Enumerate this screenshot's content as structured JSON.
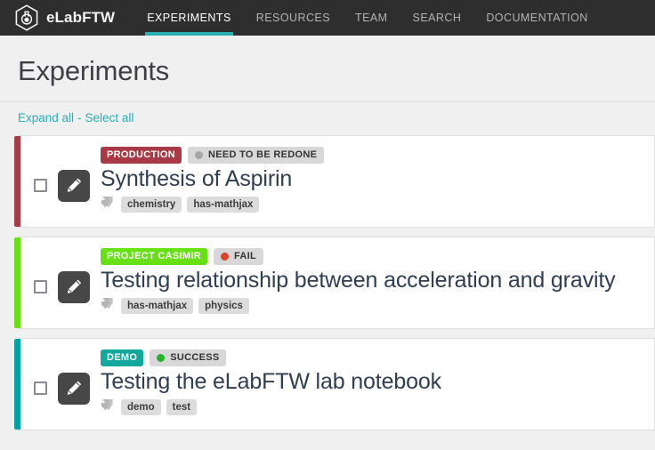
{
  "navbar": {
    "brand": "eLabFTW",
    "logo_icon": "elabftw-hexagon-flask-logo",
    "items": [
      {
        "label": "EXPERIMENTS",
        "active": true
      },
      {
        "label": "RESOURCES",
        "active": false
      },
      {
        "label": "TEAM",
        "active": false
      },
      {
        "label": "SEARCH",
        "active": false
      },
      {
        "label": "DOCUMENTATION",
        "active": false
      }
    ],
    "accent_color": "#29aeb4",
    "background_color": "#2e2e2e"
  },
  "page": {
    "title": "Experiments"
  },
  "actions": {
    "expand_all": "Expand all",
    "separator": "-",
    "select_all": "Select all",
    "link_color": "#29aeb4"
  },
  "experiments": [
    {
      "accent_color": "#a83a45",
      "category": "PRODUCTION",
      "category_color": "#a83a45",
      "status": "NEED TO BE REDONE",
      "status_dot_color": "#a6a6a6",
      "title": "Synthesis of Aspirin",
      "tags": [
        "chemistry",
        "has-mathjax"
      ],
      "edit_icon": "pencil-icon",
      "tags_icon": "tags-icon"
    },
    {
      "accent_color": "#67e016",
      "category": "PROJECT CASIMIR",
      "category_color": "#67e016",
      "status": "FAIL",
      "status_dot_color": "#d9442a",
      "title": "Testing relationship between acceleration and gravity",
      "tags": [
        "has-mathjax",
        "physics"
      ],
      "edit_icon": "pencil-icon",
      "tags_icon": "tags-icon"
    },
    {
      "accent_color": "#00a3a3",
      "category": "DEMO",
      "category_color": "#12a89d",
      "status": "SUCCESS",
      "status_dot_color": "#29b32a",
      "title": "Testing the eLabFTW lab notebook",
      "tags": [
        "demo",
        "test"
      ],
      "edit_icon": "pencil-icon",
      "tags_icon": "tags-icon"
    }
  ]
}
